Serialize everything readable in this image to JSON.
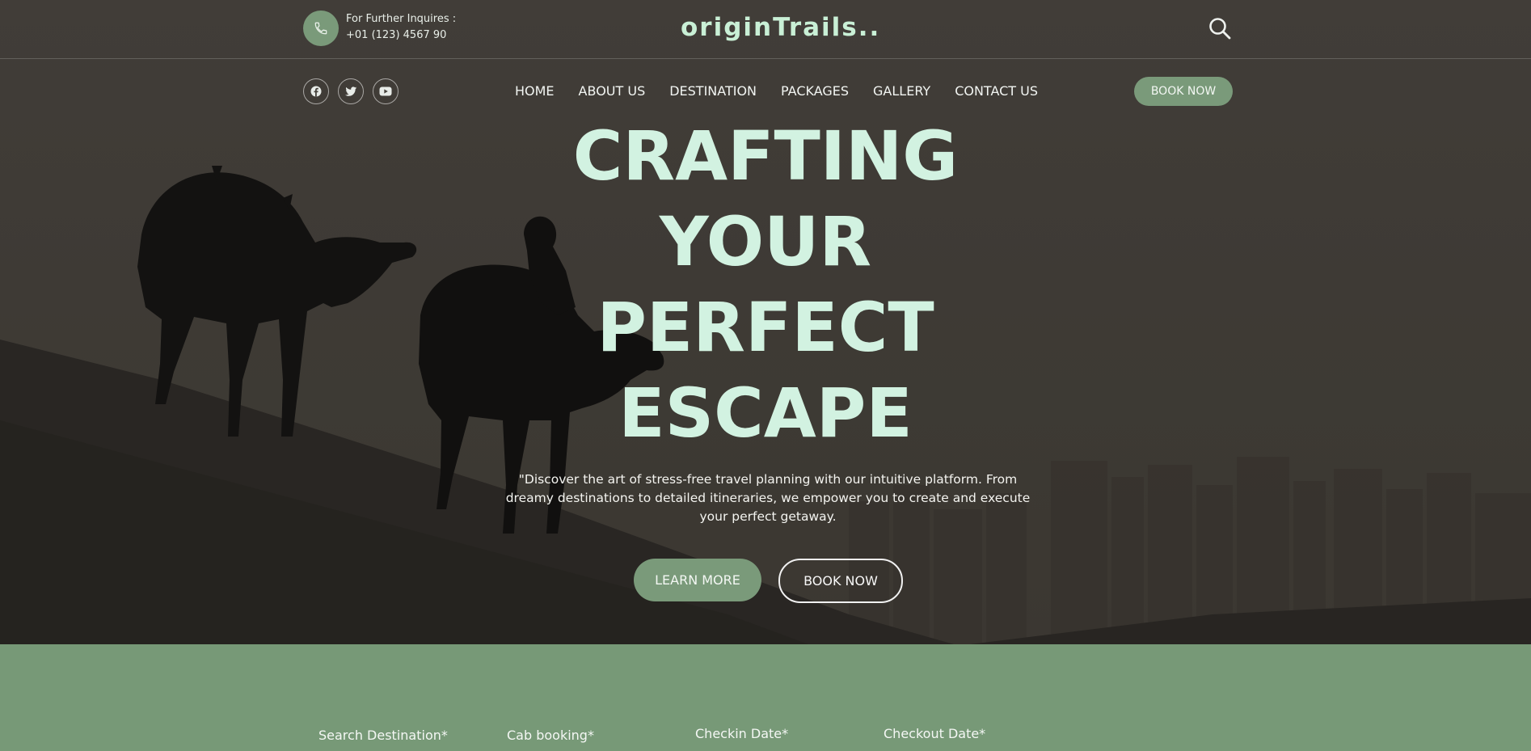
{
  "topbar": {
    "inquiry_label": "For Further Inquires :",
    "inquiry_phone": "+01 (123) 4567 90",
    "logo": "originTrails..",
    "icons": {
      "phone": "phone-icon",
      "search": "search-icon"
    }
  },
  "social": [
    "facebook-icon",
    "twitter-icon",
    "youtube-icon"
  ],
  "nav": {
    "items": [
      "HOME",
      "ABOUT US",
      "DESTINATION",
      "PACKAGES",
      "GALLERY",
      "CONTACT US"
    ],
    "book_label": "BOOK NOW"
  },
  "hero": {
    "headline": [
      "CRAFTING",
      "YOUR",
      "PERFECT",
      "ESCAPE"
    ],
    "description": "\"Discover the art of stress-free travel planning with our intuitive platform. From dreamy destinations to detailed itineraries, we empower you to create and execute your perfect getaway.",
    "learn_label": "LEARN MORE",
    "book_label": "BOOK NOW"
  },
  "booking": {
    "fields": [
      "Search Destination*",
      "Cab booking*",
      "Checkin Date*",
      "Checkout Date*"
    ]
  },
  "colors": {
    "accent": "#7a9a7a",
    "headline": "#d2f2e1",
    "logo": "#c9f0d6",
    "booking_bg": "#779977"
  }
}
